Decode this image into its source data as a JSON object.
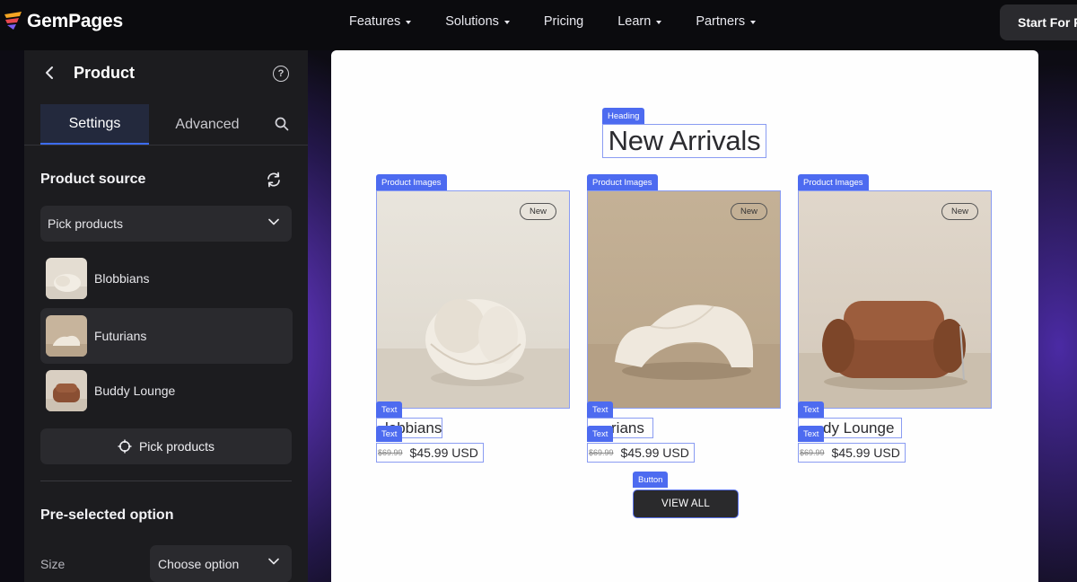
{
  "nav": {
    "logo_text": "GemPages",
    "menu": [
      {
        "label": "Features",
        "has_caret": true
      },
      {
        "label": "Solutions",
        "has_caret": true
      },
      {
        "label": "Pricing",
        "has_caret": false
      },
      {
        "label": "Learn",
        "has_caret": true
      },
      {
        "label": "Partners",
        "has_caret": true
      }
    ],
    "cta_label": "Start For F"
  },
  "panel": {
    "title": "Product",
    "help_glyph": "?",
    "tabs": {
      "settings": "Settings",
      "advanced": "Advanced"
    },
    "product_source_title": "Product source",
    "pick_select_value": "Pick products",
    "products": [
      {
        "name": "Blobbians",
        "active": false,
        "thumb": "cream-round-chair"
      },
      {
        "name": "Futurians",
        "active": true,
        "thumb": "cream-lounge-chair"
      },
      {
        "name": "Buddy Lounge",
        "active": false,
        "thumb": "brown-leather-chair"
      }
    ],
    "pick_button_label": "Pick products",
    "preselected_title": "Pre-selected option",
    "size_label": "Size",
    "size_select_value": "Choose option"
  },
  "canvas": {
    "heading_tag": "Heading",
    "heading": "New Arrivals",
    "image_tag": "Product Images",
    "text_tag": "Text",
    "badge": "New",
    "cards": [
      {
        "name_visible": "lobbians",
        "old_price": "$69.99",
        "price": "$45.99 USD"
      },
      {
        "name_visible": "rians",
        "old_price": "$69.99",
        "price": "$45.99 USD"
      },
      {
        "name_visible": "dy Lounge",
        "old_price": "$69.99",
        "price": "$45.99 USD"
      }
    ],
    "button_tag": "Button",
    "view_all_label": "VIEW ALL"
  },
  "colors": {
    "accent": "#4d6bf0",
    "panel_bg": "#1c1c1f",
    "tab_active_bg": "#23293d"
  },
  "icons": {
    "back": "chevron-left-icon",
    "help": "help-circle-icon",
    "search": "search-icon",
    "sync": "sync-icon",
    "chevron": "chevron-down-icon",
    "pick": "crosshair-icon"
  }
}
